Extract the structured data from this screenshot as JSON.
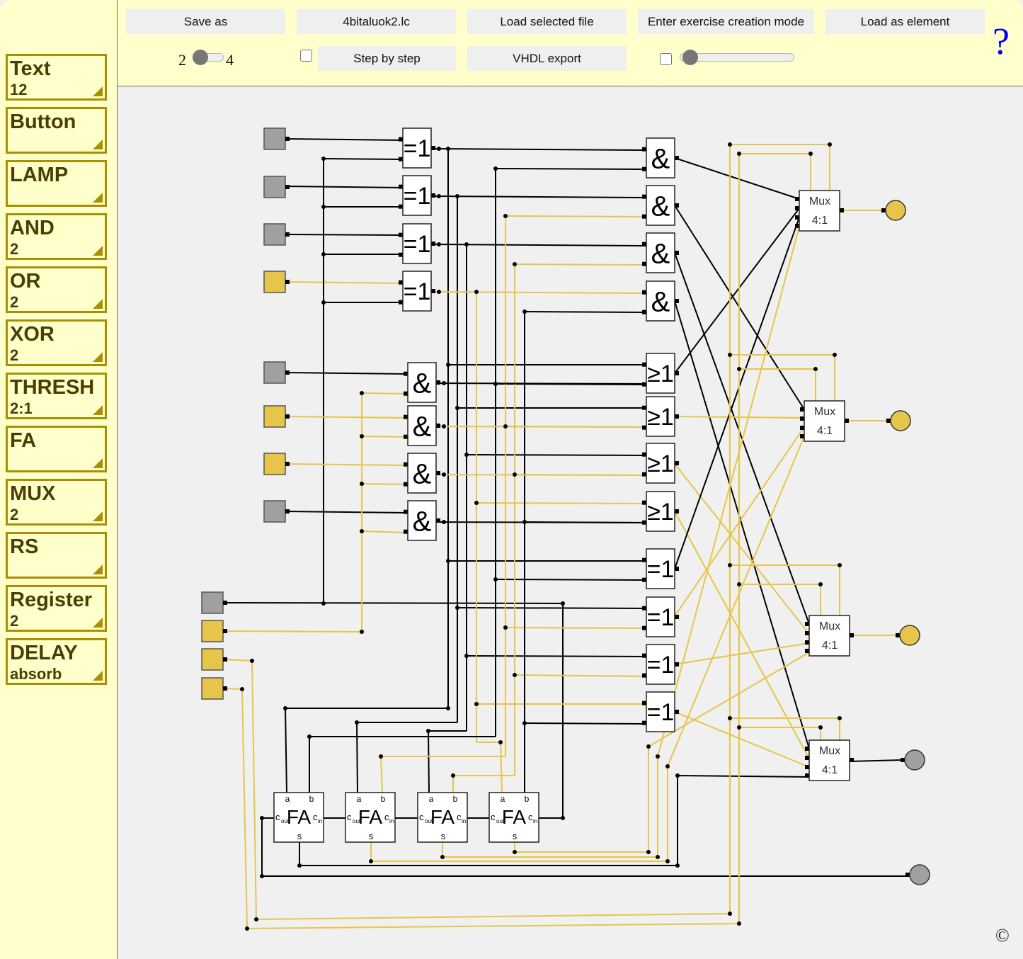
{
  "toolbar": {
    "save_as": "Save as",
    "file_name": "4bitaluok2.lc",
    "load_selected": "Load selected file",
    "exercise_mode": "Enter exercise creation mode",
    "load_as_element": "Load as element",
    "step_by_step": "Step by step",
    "vhdl_export": "VHDL export",
    "size_min": "2",
    "size_max": "4",
    "size_slider_value": 2,
    "speed_slider_value": 0,
    "step_checked": false,
    "extra_checked": false,
    "help": "?"
  },
  "palette": [
    {
      "label": "Text",
      "sub": "12"
    },
    {
      "label": "Button",
      "sub": ""
    },
    {
      "label": "LAMP",
      "sub": ""
    },
    {
      "label": "AND",
      "sub": "2"
    },
    {
      "label": "OR",
      "sub": "2"
    },
    {
      "label": "XOR",
      "sub": "2"
    },
    {
      "label": "THRESH",
      "sub": "2:1"
    },
    {
      "label": "FA",
      "sub": ""
    },
    {
      "label": "MUX",
      "sub": "2"
    },
    {
      "label": "RS",
      "sub": ""
    },
    {
      "label": "Register",
      "sub": "2"
    },
    {
      "label": "DELAY",
      "sub": "absorb"
    }
  ],
  "circuit": {
    "colors": {
      "on": "#e6c54a",
      "off": "#a0a0a0",
      "wire_on": "#e6c54a",
      "wire_off": "#000000"
    },
    "inputs": [
      "off",
      "off",
      "off",
      "on",
      "off",
      "on",
      "on",
      "off",
      "off",
      "on",
      "on",
      "on"
    ],
    "gates_xor1": [
      "=1",
      "=1",
      "=1",
      "=1"
    ],
    "gates_and1": [
      "&",
      "&",
      "&",
      "&"
    ],
    "gates_and2": [
      "&",
      "&",
      "&",
      "&"
    ],
    "gates_or2": [
      "≥1",
      "≥1",
      "≥1",
      "≥1"
    ],
    "gates_xor2": [
      "=1",
      "=1",
      "=1",
      "=1"
    ],
    "mux": {
      "title": "Mux",
      "sub": "4:1"
    },
    "fa": {
      "title": "FA",
      "a": "a",
      "b": "b",
      "cout": "c",
      "cout_sub": "out",
      "cin": "c",
      "cin_sub": "in",
      "s": "s"
    },
    "outputs": [
      "on",
      "on",
      "on",
      "off",
      "off"
    ]
  },
  "footer": {
    "copyright": "©"
  }
}
